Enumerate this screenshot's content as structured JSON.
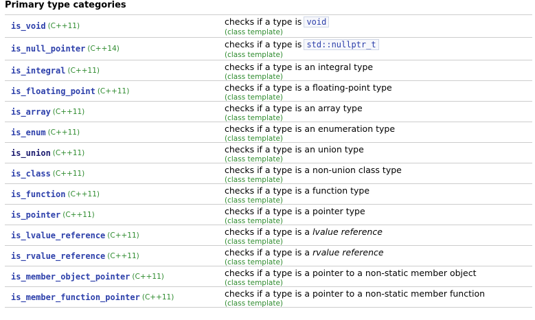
{
  "heading": "Primary type categories",
  "rows": [
    {
      "name": "is_void",
      "version": "(C++11)",
      "desc": "checks if a type is",
      "code": "void",
      "desc_em": "",
      "kind": "(class template)"
    },
    {
      "name": "is_null_pointer",
      "version": "(C++14)",
      "desc": "checks if a type is",
      "code": "std::nullptr_t",
      "desc_em": "",
      "kind": "(class template)"
    },
    {
      "name": "is_integral",
      "version": "(C++11)",
      "desc": "checks if a type is an integral type",
      "code": "",
      "desc_em": "",
      "kind": "(class template)"
    },
    {
      "name": "is_floating_point",
      "version": "(C++11)",
      "desc": "checks if a type is a floating-point type",
      "code": "",
      "desc_em": "",
      "kind": "(class template)"
    },
    {
      "name": "is_array",
      "version": "(C++11)",
      "desc": "checks if a type is an array type",
      "code": "",
      "desc_em": "",
      "kind": "(class template)"
    },
    {
      "name": "is_enum",
      "version": "(C++11)",
      "desc": "checks if a type is an enumeration type",
      "code": "",
      "desc_em": "",
      "kind": "(class template)"
    },
    {
      "name": "is_union",
      "version": "(C++11)",
      "desc": "checks if a type is an union type",
      "code": "",
      "desc_em": "",
      "kind": "(class template)"
    },
    {
      "name": "is_class",
      "version": "(C++11)",
      "desc": "checks if a type is a non-union class type",
      "code": "",
      "desc_em": "",
      "kind": "(class template)"
    },
    {
      "name": "is_function",
      "version": "(C++11)",
      "desc": "checks if a type is a function type",
      "code": "",
      "desc_em": "",
      "kind": "(class template)"
    },
    {
      "name": "is_pointer",
      "version": "(C++11)",
      "desc": "checks if a type is a pointer type",
      "code": "",
      "desc_em": "",
      "kind": "(class template)"
    },
    {
      "name": "is_lvalue_reference",
      "version": "(C++11)",
      "desc": "checks if a type is a",
      "code": "",
      "desc_em": "lvalue reference",
      "kind": "(class template)"
    },
    {
      "name": "is_rvalue_reference",
      "version": "(C++11)",
      "desc": "checks if a type is a",
      "code": "",
      "desc_em": "rvalue reference",
      "kind": "(class template)"
    },
    {
      "name": "is_member_object_pointer",
      "version": "(C++11)",
      "desc": "checks if a type is a pointer to a non-static member object",
      "code": "",
      "desc_em": "",
      "kind": "(class template)"
    },
    {
      "name": "is_member_function_pointer",
      "version": "(C++11)",
      "desc": "checks if a type is a pointer to a non-static member function",
      "code": "",
      "desc_em": "",
      "kind": "(class template)"
    }
  ]
}
